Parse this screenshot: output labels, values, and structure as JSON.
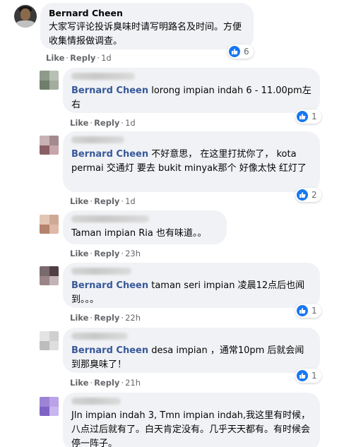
{
  "comments": [
    {
      "author": "Bernard Cheen",
      "text": "大家写评论投诉臭味时请写明路名及时间。方便收集情报做调查。",
      "actions": {
        "like": "Like",
        "reply": "Reply",
        "time": "1d"
      },
      "reactions": "6"
    },
    {
      "tag": "Bernard Cheen",
      "text": " lorong impian indah 6 - 11.00pm左右",
      "actions": {
        "like": "Like",
        "reply": "Reply",
        "time": "1d"
      },
      "reactions": "1"
    },
    {
      "tag": "Bernard Cheen",
      "text": " 不好意思， 在这里打扰你了， kota permai 交通灯 要去 bukit minyak那个 好像太快 红灯了",
      "actions": {
        "like": "Like",
        "reply": "Reply",
        "time": "1d"
      },
      "reactions": "2"
    },
    {
      "text": "Taman impian Ria 也有味道。。",
      "actions": {
        "like": "Like",
        "reply": "Reply",
        "time": "23h"
      }
    },
    {
      "tag": "Bernard Cheen",
      "text": " taman seri impian 凌晨12点后也闻到。。。",
      "actions": {
        "like": "Like",
        "reply": "Reply",
        "time": "22h"
      },
      "reactions": "1"
    },
    {
      "tag": "Bernard Cheen",
      "text": " desa impian ，通常10pm 后就会闻到那臭味了！",
      "actions": {
        "like": "Like",
        "reply": "Reply",
        "time": "21h"
      },
      "reactions": "1"
    },
    {
      "text": "Jln impian indah 3, Tmn impian indah,我这里有时候，八点过后就有了。白天肯定没有。几乎天天都有。有时候会停一阵子。"
    }
  ],
  "colors": {
    "bubble": "#f0f2f5",
    "tag": "#385898",
    "meta": "#65676b",
    "like_blue": "#1877f2"
  },
  "icons": [
    "avatar",
    "like-icon"
  ]
}
